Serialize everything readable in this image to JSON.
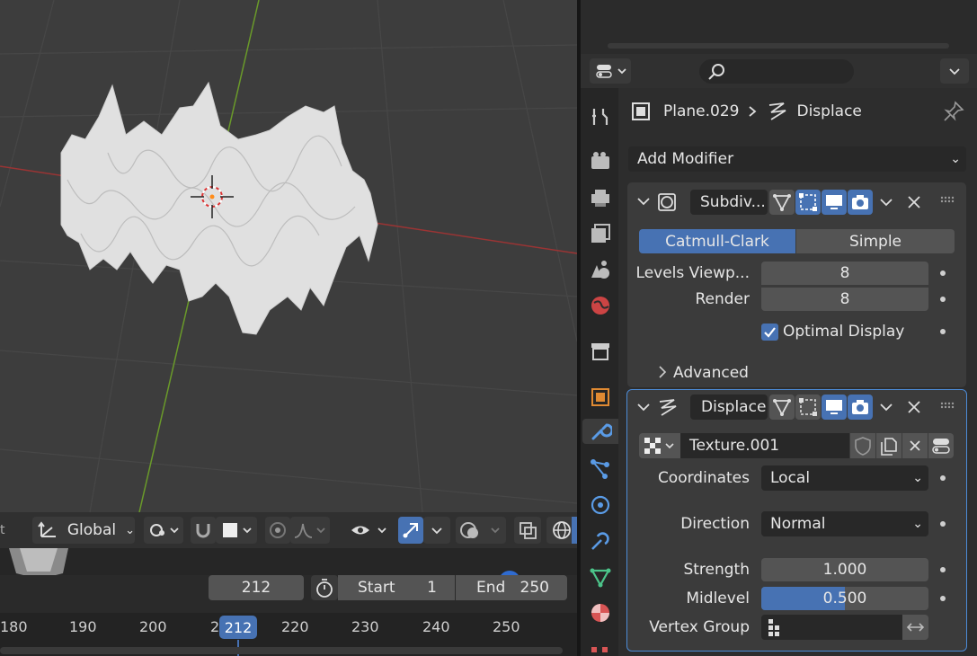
{
  "viewport": {
    "mesh_label": "Plane.029"
  },
  "viewport_header": {
    "orientation_label": "Global"
  },
  "timeline": {
    "current_frame": "212",
    "start_label": "Start",
    "start_value": "1",
    "end_label": "End",
    "end_value": "250",
    "ruler_ticks": [
      "180",
      "190",
      "200",
      "2",
      "220",
      "230",
      "240",
      "250"
    ],
    "playhead_label": "212"
  },
  "properties": {
    "search_placeholder": "",
    "breadcrumb": {
      "object": "Plane.029",
      "modifier": "Displace"
    },
    "add_modifier_label": "Add Modifier",
    "subdivision": {
      "name": "Subdiv...",
      "tab_catmull": "Catmull-Clark",
      "tab_simple": "Simple",
      "levels_viewport_label": "Levels Viewp...",
      "levels_viewport_value": "8",
      "render_label": "Render",
      "render_value": "8",
      "optimal_display_label": "Optimal Display",
      "optimal_display_checked": true,
      "advanced_label": "Advanced"
    },
    "displace": {
      "name": "Displace",
      "texture_name": "Texture.001",
      "coordinates_label": "Coordinates",
      "coordinates_value": "Local",
      "direction_label": "Direction",
      "direction_value": "Normal",
      "strength_label": "Strength",
      "strength_value": "1.000",
      "midlevel_label": "Midlevel",
      "midlevel_value": "0.500",
      "midlevel_fraction": 0.5,
      "vertex_group_label": "Vertex Group",
      "vertex_group_value": ""
    }
  },
  "colors": {
    "accent": "#4772b3",
    "x_axis": "#9a3434",
    "y_axis": "#6a9a2a",
    "mesh": "#e2e2e2"
  }
}
